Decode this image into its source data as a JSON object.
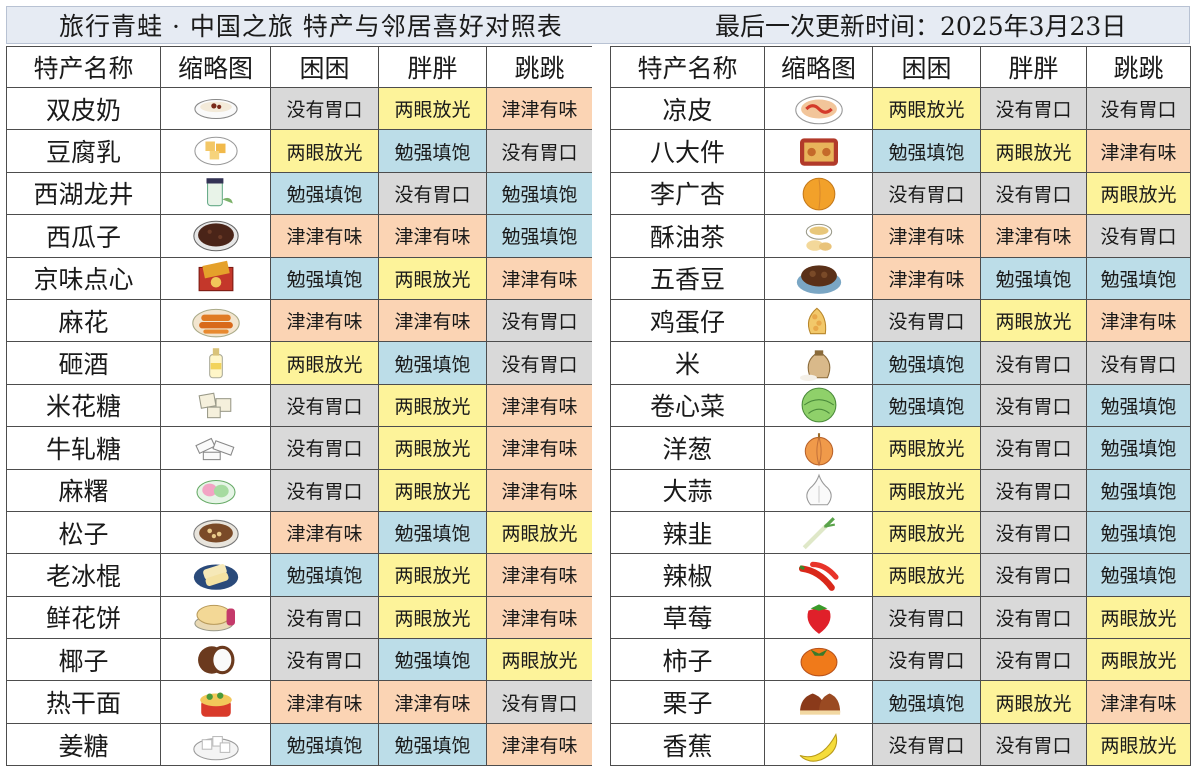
{
  "header": {
    "title": "旅行青蛙 · 中国之旅 特产与邻居喜好对照表",
    "updated": "最后一次更新时间：2025年3月23日"
  },
  "columns": [
    "特产名称",
    "缩略图",
    "困困",
    "胖胖",
    "跳跳"
  ],
  "legend_colors": {
    "没有胃口": "#d9d9d9",
    "两眼放光": "#fdf39a",
    "勉强填饱": "#bcdde8",
    "津津有味": "#fbd4b4"
  },
  "left_rows": [
    {
      "name": "双皮奶",
      "icon": "double-skin-milk-icon",
      "prefs": [
        "没有胃口",
        "两眼放光",
        "津津有味"
      ]
    },
    {
      "name": "豆腐乳",
      "icon": "fermented-tofu-icon",
      "prefs": [
        "两眼放光",
        "勉强填饱",
        "没有胃口"
      ]
    },
    {
      "name": "西湖龙井",
      "icon": "longjing-tea-icon",
      "prefs": [
        "勉强填饱",
        "没有胃口",
        "勉强填饱"
      ]
    },
    {
      "name": "西瓜子",
      "icon": "melon-seeds-icon",
      "prefs": [
        "津津有味",
        "津津有味",
        "勉强填饱"
      ]
    },
    {
      "name": "京味点心",
      "icon": "beijing-pastry-icon",
      "prefs": [
        "勉强填饱",
        "两眼放光",
        "津津有味"
      ]
    },
    {
      "name": "麻花",
      "icon": "fried-dough-twist-icon",
      "prefs": [
        "津津有味",
        "津津有味",
        "没有胃口"
      ]
    },
    {
      "name": "砸酒",
      "icon": "rice-wine-icon",
      "prefs": [
        "两眼放光",
        "勉强填饱",
        "没有胃口"
      ]
    },
    {
      "name": "米花糖",
      "icon": "rice-candy-icon",
      "prefs": [
        "没有胃口",
        "两眼放光",
        "津津有味"
      ]
    },
    {
      "name": "牛轧糖",
      "icon": "nougat-icon",
      "prefs": [
        "没有胃口",
        "两眼放光",
        "津津有味"
      ]
    },
    {
      "name": "麻糬",
      "icon": "mochi-icon",
      "prefs": [
        "没有胃口",
        "两眼放光",
        "津津有味"
      ]
    },
    {
      "name": "松子",
      "icon": "pine-nuts-icon",
      "prefs": [
        "津津有味",
        "勉强填饱",
        "两眼放光"
      ]
    },
    {
      "name": "老冰棍",
      "icon": "popsicle-icon",
      "prefs": [
        "勉强填饱",
        "两眼放光",
        "津津有味"
      ]
    },
    {
      "name": "鲜花饼",
      "icon": "flower-cake-icon",
      "prefs": [
        "没有胃口",
        "两眼放光",
        "津津有味"
      ]
    },
    {
      "name": "椰子",
      "icon": "coconut-icon",
      "prefs": [
        "没有胃口",
        "勉强填饱",
        "两眼放光"
      ]
    },
    {
      "name": "热干面",
      "icon": "hot-dry-noodles-icon",
      "prefs": [
        "津津有味",
        "津津有味",
        "没有胃口"
      ]
    },
    {
      "name": "姜糖",
      "icon": "ginger-candy-icon",
      "prefs": [
        "勉强填饱",
        "勉强填饱",
        "津津有味"
      ]
    }
  ],
  "right_rows": [
    {
      "name": "凉皮",
      "icon": "cold-noodles-icon",
      "prefs": [
        "两眼放光",
        "没有胃口",
        "没有胃口"
      ]
    },
    {
      "name": "八大件",
      "icon": "eight-pastries-icon",
      "prefs": [
        "勉强填饱",
        "两眼放光",
        "津津有味"
      ]
    },
    {
      "name": "李广杏",
      "icon": "apricot-icon",
      "prefs": [
        "没有胃口",
        "没有胃口",
        "两眼放光"
      ]
    },
    {
      "name": "酥油茶",
      "icon": "butter-tea-icon",
      "prefs": [
        "津津有味",
        "津津有味",
        "没有胃口"
      ]
    },
    {
      "name": "五香豆",
      "icon": "spiced-beans-icon",
      "prefs": [
        "津津有味",
        "勉强填饱",
        "勉强填饱"
      ]
    },
    {
      "name": "鸡蛋仔",
      "icon": "egg-waffle-icon",
      "prefs": [
        "没有胃口",
        "两眼放光",
        "津津有味"
      ]
    },
    {
      "name": "米",
      "icon": "rice-sack-icon",
      "prefs": [
        "勉强填饱",
        "没有胃口",
        "没有胃口"
      ]
    },
    {
      "name": "卷心菜",
      "icon": "cabbage-icon",
      "prefs": [
        "勉强填饱",
        "没有胃口",
        "勉强填饱"
      ]
    },
    {
      "name": "洋葱",
      "icon": "onion-icon",
      "prefs": [
        "两眼放光",
        "没有胃口",
        "勉强填饱"
      ]
    },
    {
      "name": "大蒜",
      "icon": "garlic-icon",
      "prefs": [
        "两眼放光",
        "没有胃口",
        "勉强填饱"
      ]
    },
    {
      "name": "辣韭",
      "icon": "leek-icon",
      "prefs": [
        "两眼放光",
        "没有胃口",
        "勉强填饱"
      ]
    },
    {
      "name": "辣椒",
      "icon": "chili-pepper-icon",
      "prefs": [
        "两眼放光",
        "没有胃口",
        "勉强填饱"
      ]
    },
    {
      "name": "草莓",
      "icon": "strawberry-icon",
      "prefs": [
        "没有胃口",
        "没有胃口",
        "两眼放光"
      ]
    },
    {
      "name": "柿子",
      "icon": "persimmon-icon",
      "prefs": [
        "没有胃口",
        "没有胃口",
        "两眼放光"
      ]
    },
    {
      "name": "栗子",
      "icon": "chestnut-icon",
      "prefs": [
        "勉强填饱",
        "两眼放光",
        "津津有味"
      ]
    },
    {
      "name": "香蕉",
      "icon": "banana-icon",
      "prefs": [
        "没有胃口",
        "没有胃口",
        "两眼放光"
      ]
    }
  ]
}
